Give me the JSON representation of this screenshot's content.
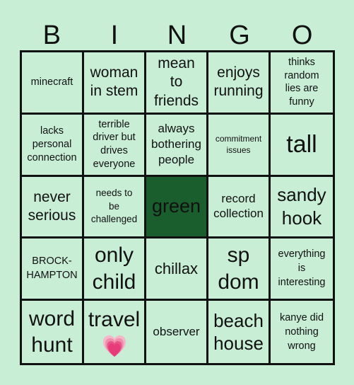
{
  "header": {
    "letters": [
      "B",
      "I",
      "N",
      "G",
      "O"
    ]
  },
  "colors": {
    "background": "#c8eed6",
    "free_cell": "#1a5e2e",
    "grid_lines": "#111111"
  },
  "board": {
    "rows": [
      [
        {
          "text": "minecraft"
        },
        {
          "text": "woman in stem"
        },
        {
          "text": "mean to friends"
        },
        {
          "text": "enjoys running"
        },
        {
          "text": "thinks random lies are funny"
        }
      ],
      [
        {
          "text": "lacks personal connection"
        },
        {
          "text": "terrible driver but drives everyone"
        },
        {
          "text": "always bothering people"
        },
        {
          "text": "commitment issues"
        },
        {
          "text": "tall"
        }
      ],
      [
        {
          "text": "never serious"
        },
        {
          "text": "needs to be challenged"
        },
        {
          "text": "green"
        },
        {
          "text": "record collection"
        },
        {
          "text": "sandy hook"
        }
      ],
      [
        {
          "text": "BROCK-HAMPTON"
        },
        {
          "text": "only child"
        },
        {
          "text": "chillax"
        },
        {
          "text": "sp dom"
        },
        {
          "text": "everything is interesting"
        }
      ],
      [
        {
          "text": "word hunt"
        },
        {
          "text": "travel",
          "icon": "growing-heart-icon"
        },
        {
          "text": "observer"
        },
        {
          "text": "beach house"
        },
        {
          "text": "kanye did nothing wrong"
        }
      ]
    ]
  }
}
